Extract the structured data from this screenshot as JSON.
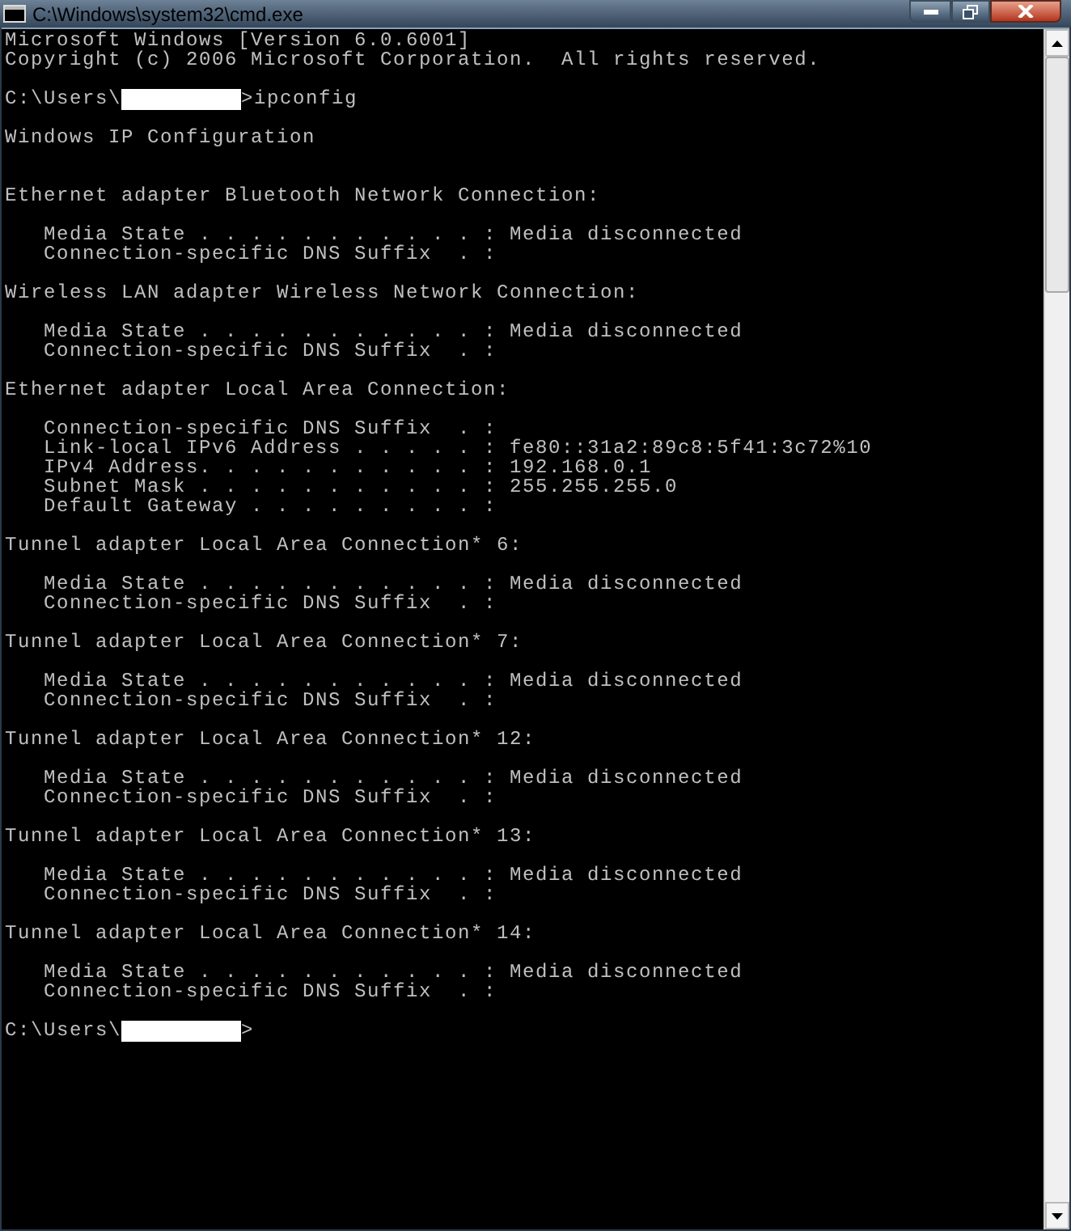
{
  "window": {
    "title": "C:\\Windows\\system32\\cmd.exe"
  },
  "lines": [
    {
      "kind": "text",
      "text": "Microsoft Windows [Version 6.0.6001]"
    },
    {
      "kind": "text",
      "text": "Copyright (c) 2006 Microsoft Corporation.  All rights reserved."
    },
    {
      "kind": "blank"
    },
    {
      "kind": "prompt",
      "path": "C:\\Users\\",
      "redacted": true,
      "command": ">ipconfig"
    },
    {
      "kind": "blank"
    },
    {
      "kind": "text",
      "text": "Windows IP Configuration"
    },
    {
      "kind": "blank"
    },
    {
      "kind": "blank"
    },
    {
      "kind": "text",
      "text": "Ethernet adapter Bluetooth Network Connection:"
    },
    {
      "kind": "blank"
    },
    {
      "kind": "text",
      "text": "   Media State . . . . . . . . . . . : Media disconnected"
    },
    {
      "kind": "text",
      "text": "   Connection-specific DNS Suffix  . :"
    },
    {
      "kind": "blank"
    },
    {
      "kind": "text",
      "text": "Wireless LAN adapter Wireless Network Connection:"
    },
    {
      "kind": "blank"
    },
    {
      "kind": "text",
      "text": "   Media State . . . . . . . . . . . : Media disconnected"
    },
    {
      "kind": "text",
      "text": "   Connection-specific DNS Suffix  . :"
    },
    {
      "kind": "blank"
    },
    {
      "kind": "text",
      "text": "Ethernet adapter Local Area Connection:"
    },
    {
      "kind": "blank"
    },
    {
      "kind": "text",
      "text": "   Connection-specific DNS Suffix  . :"
    },
    {
      "kind": "text",
      "text": "   Link-local IPv6 Address . . . . . : fe80::31a2:89c8:5f41:3c72%10"
    },
    {
      "kind": "text",
      "text": "   IPv4 Address. . . . . . . . . . . : 192.168.0.1"
    },
    {
      "kind": "text",
      "text": "   Subnet Mask . . . . . . . . . . . : 255.255.255.0"
    },
    {
      "kind": "text",
      "text": "   Default Gateway . . . . . . . . . :"
    },
    {
      "kind": "blank"
    },
    {
      "kind": "text",
      "text": "Tunnel adapter Local Area Connection* 6:"
    },
    {
      "kind": "blank"
    },
    {
      "kind": "text",
      "text": "   Media State . . . . . . . . . . . : Media disconnected"
    },
    {
      "kind": "text",
      "text": "   Connection-specific DNS Suffix  . :"
    },
    {
      "kind": "blank"
    },
    {
      "kind": "text",
      "text": "Tunnel adapter Local Area Connection* 7:"
    },
    {
      "kind": "blank"
    },
    {
      "kind": "text",
      "text": "   Media State . . . . . . . . . . . : Media disconnected"
    },
    {
      "kind": "text",
      "text": "   Connection-specific DNS Suffix  . :"
    },
    {
      "kind": "blank"
    },
    {
      "kind": "text",
      "text": "Tunnel adapter Local Area Connection* 12:"
    },
    {
      "kind": "blank"
    },
    {
      "kind": "text",
      "text": "   Media State . . . . . . . . . . . : Media disconnected"
    },
    {
      "kind": "text",
      "text": "   Connection-specific DNS Suffix  . :"
    },
    {
      "kind": "blank"
    },
    {
      "kind": "text",
      "text": "Tunnel adapter Local Area Connection* 13:"
    },
    {
      "kind": "blank"
    },
    {
      "kind": "text",
      "text": "   Media State . . . . . . . . . . . : Media disconnected"
    },
    {
      "kind": "text",
      "text": "   Connection-specific DNS Suffix  . :"
    },
    {
      "kind": "blank"
    },
    {
      "kind": "text",
      "text": "Tunnel adapter Local Area Connection* 14:"
    },
    {
      "kind": "blank"
    },
    {
      "kind": "text",
      "text": "   Media State . . . . . . . . . . . : Media disconnected"
    },
    {
      "kind": "text",
      "text": "   Connection-specific DNS Suffix  . :"
    },
    {
      "kind": "blank"
    },
    {
      "kind": "prompt",
      "path": "C:\\Users\\",
      "redacted": true,
      "command": ">"
    }
  ]
}
